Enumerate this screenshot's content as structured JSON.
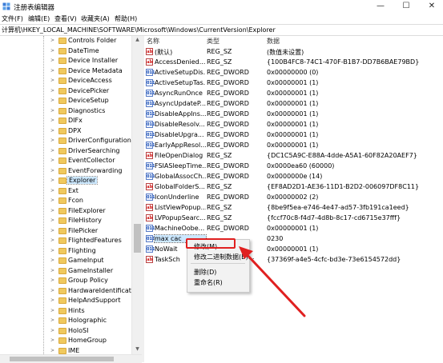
{
  "window": {
    "title": "注册表编辑器",
    "controls": {
      "minimize": "—",
      "maximize": "☐",
      "close": "✕"
    }
  },
  "menu": [
    "文件(F)",
    "编辑(E)",
    "查看(V)",
    "收藏夹(A)",
    "帮助(H)"
  ],
  "address": "计算机\\HKEY_LOCAL_MACHINE\\SOFTWARE\\Microsoft\\Windows\\CurrentVersion\\Explorer",
  "tree": {
    "items": [
      {
        "label": "Controls Folder",
        "selected": false
      },
      {
        "label": "DateTime",
        "selected": false
      },
      {
        "label": "Device Installer",
        "selected": false
      },
      {
        "label": "Device Metadata",
        "selected": false
      },
      {
        "label": "DeviceAccess",
        "selected": false
      },
      {
        "label": "DevicePicker",
        "selected": false
      },
      {
        "label": "DeviceSetup",
        "selected": false
      },
      {
        "label": "Diagnostics",
        "selected": false
      },
      {
        "label": "DIFx",
        "selected": false
      },
      {
        "label": "DPX",
        "selected": false
      },
      {
        "label": "DriverConfiguration",
        "selected": false
      },
      {
        "label": "DriverSearching",
        "selected": false
      },
      {
        "label": "EventCollector",
        "selected": false
      },
      {
        "label": "EventForwarding",
        "selected": false
      },
      {
        "label": "Explorer",
        "selected": true
      },
      {
        "label": "Ext",
        "selected": false
      },
      {
        "label": "Fcon",
        "selected": false
      },
      {
        "label": "FileExplorer",
        "selected": false
      },
      {
        "label": "FileHistory",
        "selected": false
      },
      {
        "label": "FilePicker",
        "selected": false
      },
      {
        "label": "FlightedFeatures",
        "selected": false
      },
      {
        "label": "Flighting",
        "selected": false
      },
      {
        "label": "GameInput",
        "selected": false
      },
      {
        "label": "GameInstaller",
        "selected": false
      },
      {
        "label": "Group Policy",
        "selected": false
      },
      {
        "label": "HardwareIdentification",
        "selected": false
      },
      {
        "label": "HelpAndSupport",
        "selected": false
      },
      {
        "label": "Hints",
        "selected": false
      },
      {
        "label": "Holographic",
        "selected": false
      },
      {
        "label": "HoloSI",
        "selected": false
      },
      {
        "label": "HomeGroup",
        "selected": false
      },
      {
        "label": "IME",
        "selected": false
      }
    ]
  },
  "list": {
    "headers": [
      "名称",
      "类型",
      "数据"
    ],
    "rows": [
      {
        "icon": "ab",
        "name": "(默认)",
        "type": "REG_SZ",
        "data": "(数值未设置)"
      },
      {
        "icon": "ab",
        "name": "AccessDenied...",
        "type": "REG_SZ",
        "data": "{100B4FC8-74C1-470F-B1B7-DD7B6BAE79BD}"
      },
      {
        "icon": "bin",
        "name": "ActiveSetupDis...",
        "type": "REG_DWORD",
        "data": "0x00000000 (0)"
      },
      {
        "icon": "bin",
        "name": "ActiveSetupTas...",
        "type": "REG_DWORD",
        "data": "0x00000001 (1)"
      },
      {
        "icon": "bin",
        "name": "AsyncRunOnce",
        "type": "REG_DWORD",
        "data": "0x00000001 (1)"
      },
      {
        "icon": "bin",
        "name": "AsyncUpdateP...",
        "type": "REG_DWORD",
        "data": "0x00000001 (1)"
      },
      {
        "icon": "bin",
        "name": "DisableAppIns...",
        "type": "REG_DWORD",
        "data": "0x00000001 (1)"
      },
      {
        "icon": "bin",
        "name": "DisableResolv...",
        "type": "REG_DWORD",
        "data": "0x00000001 (1)"
      },
      {
        "icon": "bin",
        "name": "DisableUpgra...",
        "type": "REG_DWORD",
        "data": "0x00000001 (1)"
      },
      {
        "icon": "bin",
        "name": "EarlyAppResol...",
        "type": "REG_DWORD",
        "data": "0x00000001 (1)"
      },
      {
        "icon": "ab",
        "name": "FileOpenDialog",
        "type": "REG_SZ",
        "data": "{DC1C5A9C-E88A-4dde-A5A1-60F82A20AEF7}"
      },
      {
        "icon": "bin",
        "name": "FSIASleepTime...",
        "type": "REG_DWORD",
        "data": "0x0000ea60 (60000)"
      },
      {
        "icon": "bin",
        "name": "GlobalAssocCh...",
        "type": "REG_DWORD",
        "data": "0x0000000e (14)"
      },
      {
        "icon": "ab",
        "name": "GlobalFolderS...",
        "type": "REG_SZ",
        "data": "{EF8AD2D1-AE36-11D1-B2D2-006097DF8C11}"
      },
      {
        "icon": "bin",
        "name": "IconUnderline",
        "type": "REG_DWORD",
        "data": "0x00000002 (2)"
      },
      {
        "icon": "ab",
        "name": "ListViewPopup...",
        "type": "REG_SZ",
        "data": "{8be9f5ea-e746-4e47-ad57-3fb191ca1eed}"
      },
      {
        "icon": "ab",
        "name": "LVPopupSearc...",
        "type": "REG_SZ",
        "data": "{fccf70c8-f4d7-4d8b-8c17-cd6715e37fff}"
      },
      {
        "icon": "bin",
        "name": "MachineOobe...",
        "type": "REG_DWORD",
        "data": "0x00000001 (1)"
      },
      {
        "icon": "bin",
        "name": "max cac",
        "type": "",
        "data": "0230",
        "selected": true
      },
      {
        "icon": "bin",
        "name": "NoWait",
        "type": "",
        "data": "0x00000001 (1)"
      },
      {
        "icon": "ab",
        "name": "TaskSch",
        "type": "",
        "data": "{37369f-a4e5-4cfc-bd3e-73e6154572dd}"
      }
    ]
  },
  "context_menu": {
    "modify": "修改(M)...",
    "modify_binary": "修改二进制数据(B)...",
    "delete": "删除(D)",
    "rename": "重命名(R)"
  },
  "annotation": {
    "highlight_color": "#e02020",
    "arrow_color": "#e02020"
  }
}
